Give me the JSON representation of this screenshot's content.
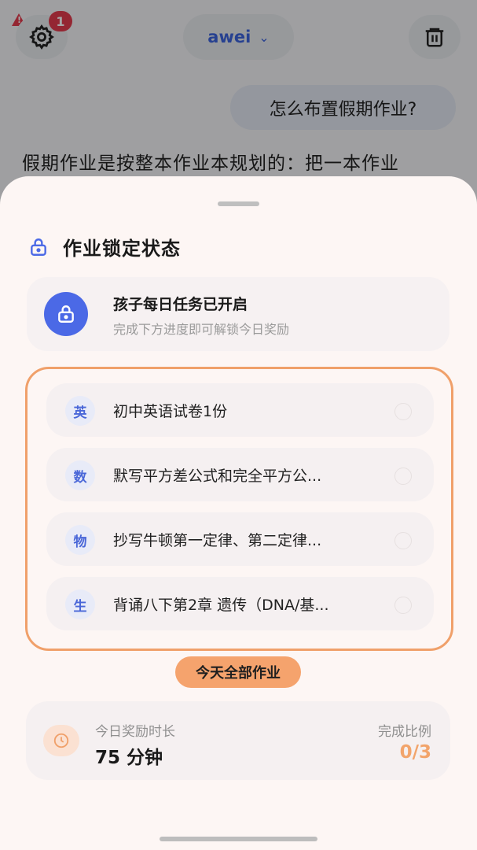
{
  "header": {
    "settings_badge": "1",
    "user_name": "awei"
  },
  "chat": {
    "user_message": "怎么布置假期作业?",
    "assistant_reply": "假期作业是按整本作业本规划的：把一本作业"
  },
  "sheet": {
    "title": "作业锁定状态",
    "status_title": "孩子每日任务已开启",
    "status_subtitle": "完成下方进度即可解锁今日奖励",
    "tasks": [
      {
        "subject": "英",
        "label": "初中英语试卷1份"
      },
      {
        "subject": "数",
        "label": "默写平方差公式和完全平方公..."
      },
      {
        "subject": "物",
        "label": "抄写牛顿第一定律、第二定律..."
      },
      {
        "subject": "生",
        "label": "背诵八下第2章 遗传（DNA/基..."
      }
    ],
    "today_button": "今天全部作业",
    "reward_label": "今日奖励时长",
    "reward_value": "75 分钟",
    "ratio_label": "完成比例",
    "ratio_value": "0/3"
  },
  "icons": {
    "settings": "gear-icon",
    "delete": "trash-icon",
    "lock": "lock-icon",
    "clock": "clock-icon",
    "warning": "warning-icon"
  },
  "colors": {
    "accent_blue": "#4b69e6",
    "accent_orange": "#f0a06a",
    "badge_red": "#e43b4e"
  }
}
